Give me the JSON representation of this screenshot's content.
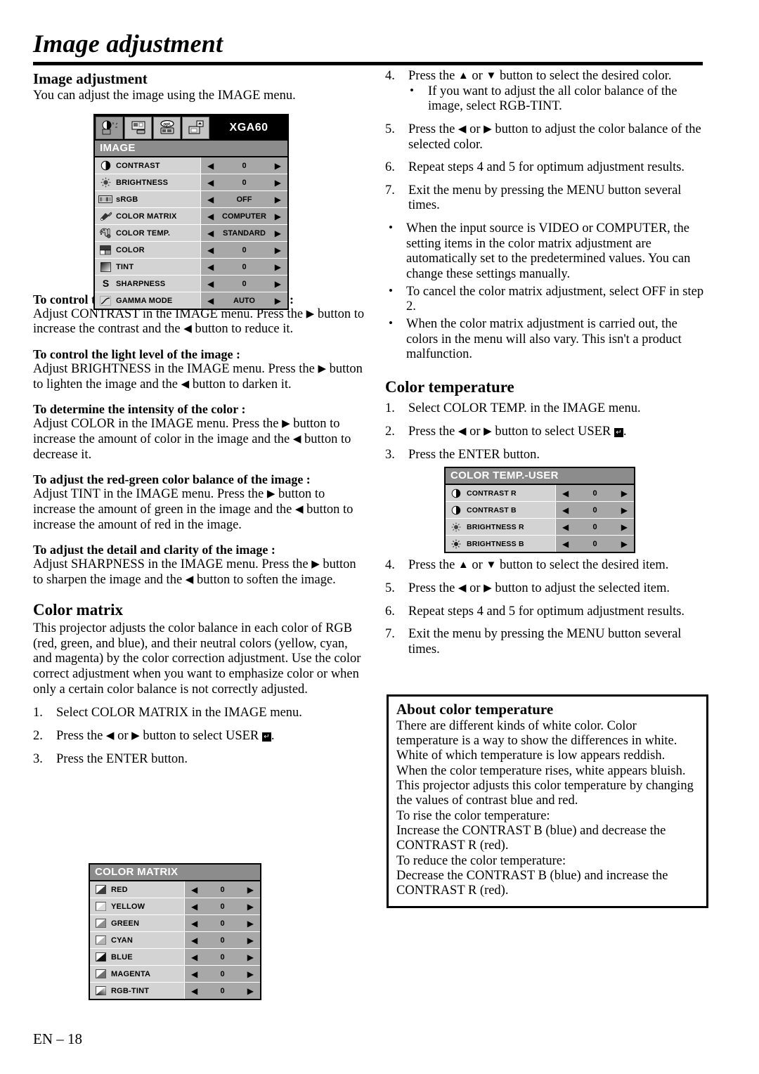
{
  "header": {
    "title": "Image adjustment"
  },
  "footer": {
    "page_label": "EN – 18"
  },
  "left_column": {
    "section_title": "Image adjustment",
    "intro": "You can adjust the image using the IMAGE menu.",
    "image_menu": {
      "source_label": "XGA60",
      "heading": "IMAGE",
      "tabs": [
        {
          "name": "image-tab",
          "active": true
        },
        {
          "name": "signal-tab",
          "active": false
        },
        {
          "name": "option-tab",
          "active": false
        },
        {
          "name": "feature-tab",
          "active": false
        }
      ],
      "rows": [
        {
          "icon": "contrast-icon",
          "label": "CONTRAST",
          "value": "0"
        },
        {
          "icon": "brightness-icon",
          "label": "BRIGHTNESS",
          "value": "0"
        },
        {
          "icon": "srgb-icon",
          "label": "sRGB",
          "value": "OFF"
        },
        {
          "icon": "color-matrix-icon",
          "label": "COLOR MATRIX",
          "value": "COMPUTER"
        },
        {
          "icon": "color-temp-icon",
          "label": "COLOR TEMP.",
          "value": "STANDARD"
        },
        {
          "icon": "color-icon",
          "label": "COLOR",
          "value": "0"
        },
        {
          "icon": "tint-icon",
          "label": "TINT",
          "value": "0"
        },
        {
          "icon": "sharpness-icon",
          "label": "SHARPNESS",
          "value": "0"
        },
        {
          "icon": "gamma-mode-icon",
          "label": "GAMMA MODE",
          "value": "AUTO"
        }
      ]
    },
    "topics": [
      {
        "heading": "To control the white-to-black level of the image :",
        "body_pre": "Adjust CONTRAST in the IMAGE menu.  Press the ",
        "body_mid": " button to increase the contrast and the ",
        "body_post": " button to reduce it."
      },
      {
        "heading": "To control the light level of the image :",
        "body_pre": "Adjust BRIGHTNESS in the IMAGE menu.  Press the ",
        "body_mid": " button to lighten the image and the ",
        "body_post": " button to darken it."
      },
      {
        "heading": "To determine the intensity of the color :",
        "body_pre": "Adjust COLOR in the IMAGE menu.  Press the ",
        "body_mid": " button to increase the amount of color in the image and the ",
        "body_post": " button to decrease it."
      },
      {
        "heading": "To adjust the red-green color balance of the image :",
        "body_pre": "Adjust TINT in the IMAGE menu.  Press the ",
        "body_mid": " button to increase the amount of green in the image and the ",
        "body_post": " button to increase the amount of red in the image."
      },
      {
        "heading": "To adjust the detail and clarity of the image :",
        "body_pre": "Adjust SHARPNESS in the IMAGE menu.  Press the ",
        "body_mid": " button to sharpen the image and the ",
        "body_post": " button to soften the image."
      }
    ],
    "color_matrix": {
      "heading": "Color matrix",
      "intro": "This projector adjusts the color balance in each color of RGB (red, green, and blue), and their neutral colors (yellow, cyan, and magenta) by the color correction adjustment. Use the color correct adjustment when you want to emphasize color or when only a certain color balance is not correctly adjusted.",
      "steps": [
        {
          "num": "1.",
          "pre": "Select COLOR MATRIX in the IMAGE menu.",
          "mid": "",
          "post": ""
        },
        {
          "num": "2.",
          "pre": "Press the ",
          "mid": " or ",
          "post": " button to select USER "
        },
        {
          "num": "3.",
          "pre": "Press the ENTER button.",
          "mid": "",
          "post": ""
        }
      ],
      "menu": {
        "heading": "COLOR MATRIX",
        "rows": [
          {
            "icon": "swatch-red-icon",
            "label": "RED",
            "value": "0"
          },
          {
            "icon": "swatch-yellow-icon",
            "label": "YELLOW",
            "value": "0"
          },
          {
            "icon": "swatch-green-icon",
            "label": "GREEN",
            "value": "0"
          },
          {
            "icon": "swatch-cyan-icon",
            "label": "CYAN",
            "value": "0"
          },
          {
            "icon": "swatch-blue-icon",
            "label": "BLUE",
            "value": "0"
          },
          {
            "icon": "swatch-magenta-icon",
            "label": "MAGENTA",
            "value": "0"
          },
          {
            "icon": "swatch-rgbtint-icon",
            "label": "RGB-TINT",
            "value": "0"
          }
        ]
      }
    }
  },
  "right_column": {
    "color_matrix_steps": [
      {
        "num": "4.",
        "pre": "Press the ",
        "mid": " or ",
        "post": " button to select the desired color."
      },
      {
        "num": "5.",
        "pre": "Press the ",
        "mid": " or ",
        "post": " button to adjust the color balance of the selected color."
      },
      {
        "num": "6.",
        "pre": "Repeat steps 4 and 5 for optimum adjustment results.",
        "mid": "",
        "post": ""
      },
      {
        "num": "7.",
        "pre": "Exit the menu by pressing the MENU button several times.",
        "mid": "",
        "post": ""
      }
    ],
    "step4_subbullet": "If you want to adjust the all color balance of the image, select RGB-TINT.",
    "notes": [
      "When the input source is VIDEO or COMPUTER, the setting items in the color matrix adjustment are automatically set to the predetermined values. You can change these settings manually.",
      "To cancel the color matrix adjustment, select OFF in step 2.",
      "When the color matrix adjustment is carried out, the colors in the menu will also vary. This isn't a product malfunction."
    ],
    "color_temperature": {
      "heading": "Color temperature",
      "steps_top": [
        {
          "num": "1.",
          "pre": "Select COLOR TEMP. in the IMAGE menu.",
          "mid": "",
          "post": ""
        },
        {
          "num": "2.",
          "pre": "Press the ",
          "mid": " or ",
          "post": " button to select USER "
        },
        {
          "num": "3.",
          "pre": "Press the ENTER button.",
          "mid": "",
          "post": ""
        }
      ],
      "menu": {
        "heading": "COLOR TEMP.-USER",
        "rows": [
          {
            "icon": "contrast-icon",
            "label": "CONTRAST R",
            "value": "0"
          },
          {
            "icon": "contrast-icon",
            "label": "CONTRAST B",
            "value": "0"
          },
          {
            "icon": "brightness-icon",
            "label": "BRIGHTNESS R",
            "value": "0"
          },
          {
            "icon": "brightness-icon",
            "label": "BRIGHTNESS B",
            "value": "0"
          }
        ]
      },
      "steps_bottom": [
        {
          "num": "4.",
          "pre": "Press the ",
          "mid": " or ",
          "post": " button to select the desired item."
        },
        {
          "num": "5.",
          "pre": "Press the ",
          "mid": " or ",
          "post": " button to adjust the selected item."
        },
        {
          "num": "6.",
          "pre": "Repeat steps 4 and 5 for optimum adjustment results.",
          "mid": "",
          "post": ""
        },
        {
          "num": "7.",
          "pre": "Exit the menu by pressing the MENU button several times.",
          "mid": "",
          "post": ""
        }
      ]
    },
    "about_box": {
      "heading": "About color temperature",
      "body": "There are different kinds of white color. Color temperature is a way to show the differences in white. White of which temperature is low appears reddish. When the color temperature rises, white appears bluish. This projector adjusts this color temperature by changing the values of contrast blue and red.\nTo rise the color temperature:\nIncrease the CONTRAST B (blue) and decrease the CONTRAST R (red).\nTo reduce the color temperature:\nDecrease the CONTRAST B (blue) and increase the CONTRAST R (red)."
    }
  },
  "glyphs": {
    "left_arrow": "◀",
    "right_arrow": "▶",
    "up_arrow": "▲",
    "down_arrow": "▼",
    "bullet": "•",
    "enter": "↵"
  },
  "colors": {
    "osd_label_bg": "#d3d3d3",
    "osd_value_bg": "#a8a8a8",
    "osd_heading_bg": "#8c8c8c",
    "osd_border": "#000000",
    "page_bg": "#ffffff",
    "text": "#000000"
  }
}
